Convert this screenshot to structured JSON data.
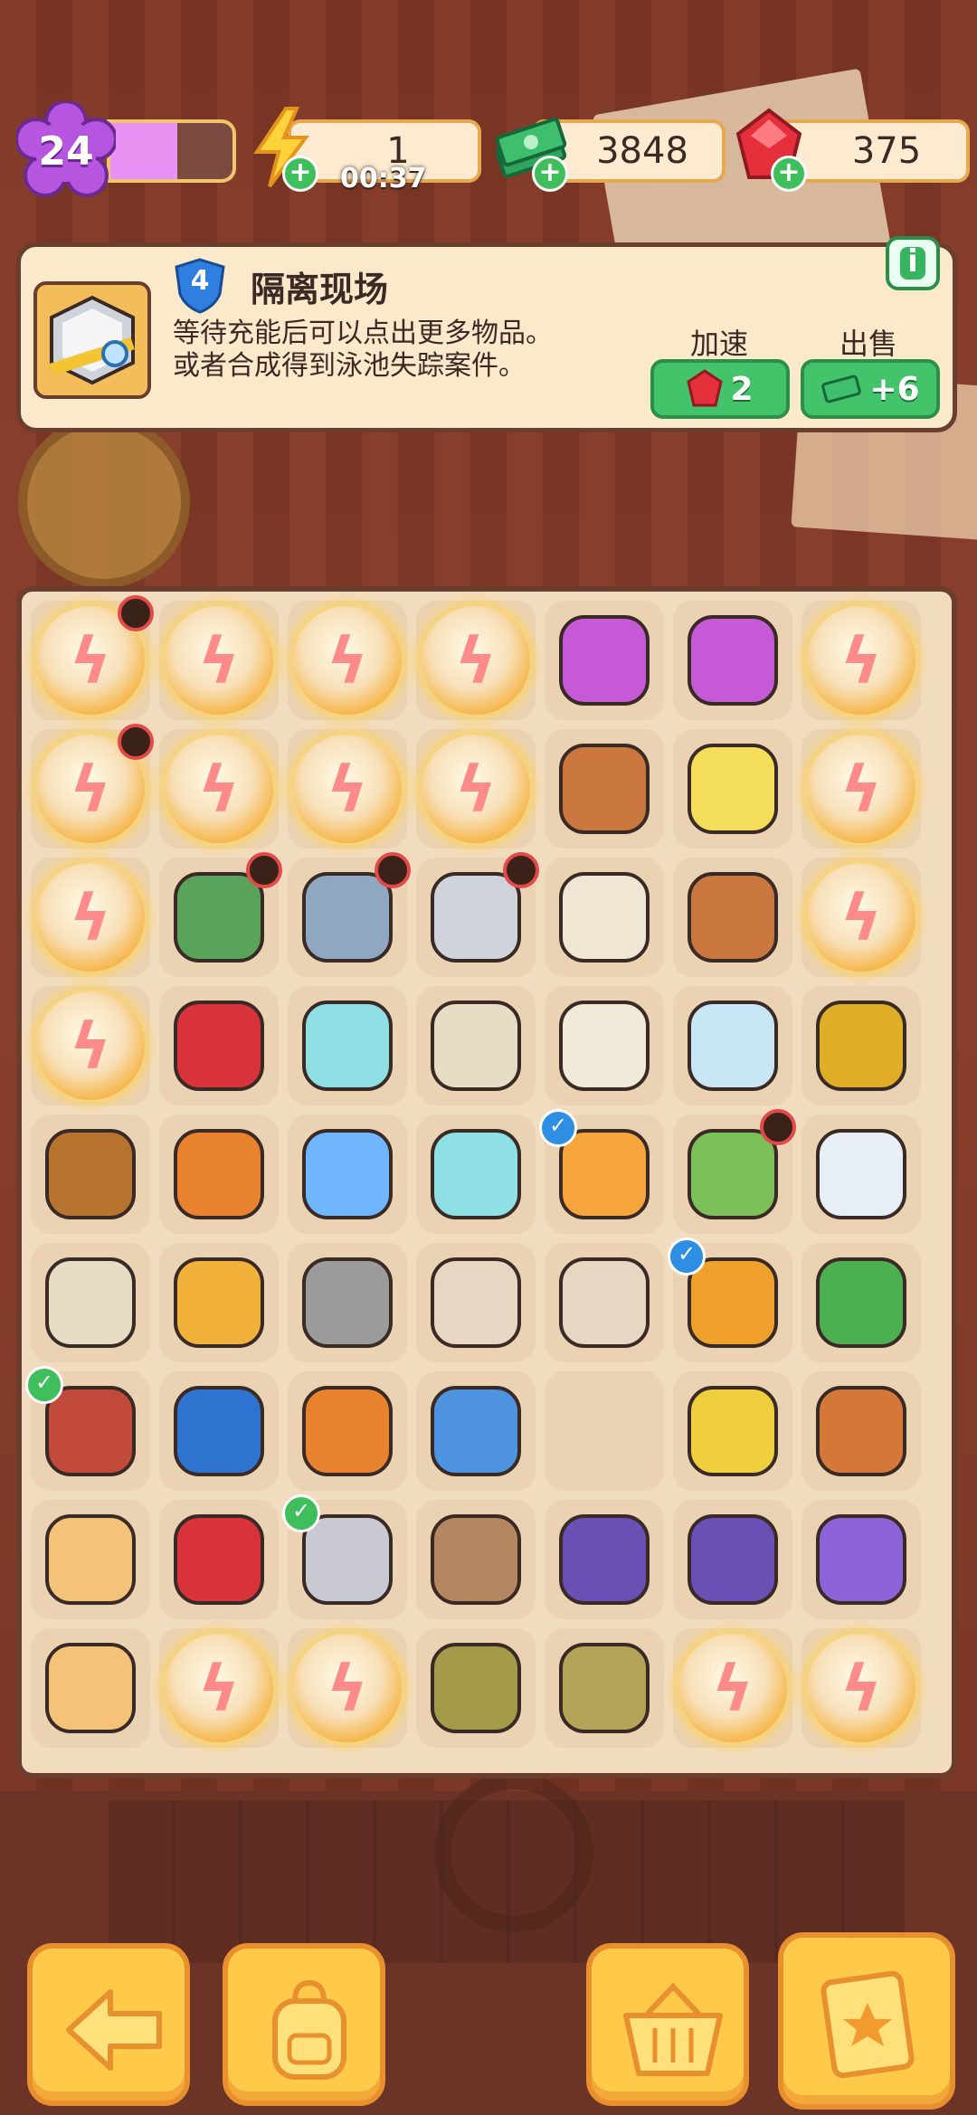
{
  "topbar": {
    "level": "24",
    "xp_progress": 0.55,
    "energy": "1",
    "energy_timer": "00:37",
    "cash": "3848",
    "gems": "375"
  },
  "panel": {
    "tier": "4",
    "title": "隔离现场",
    "desc_line1": "等待充能后可以点出更多物品。",
    "desc_line2": "或者合成得到泳池失踪案件。",
    "speedup_label": "加速",
    "speedup_cost": "2",
    "sell_label": "出售",
    "sell_value": "+6",
    "info_label": "i"
  },
  "board": {
    "rows": [
      [
        "energy-sphere-locked",
        "energy-sphere",
        "energy-sphere",
        "energy-sphere",
        "flower-crystal-basket",
        "flower-crystal-basket",
        "energy-sphere"
      ],
      [
        "energy-sphere-locked",
        "energy-sphere",
        "energy-sphere",
        "energy-sphere",
        "clay-pot",
        "sprout-mascot",
        "energy-sphere"
      ],
      [
        "energy-sphere",
        "crime-scene-green-locked",
        "crime-scene-blue-locked",
        "crime-scene-box-locked",
        "wooden-blocks",
        "clay-pot",
        "energy-sphere"
      ],
      [
        "energy-sphere",
        "red-glove",
        "medicine-jar",
        "wanted-poster",
        "toast-slices",
        "water-bottle-sock",
        "horseshoe-magnet"
      ],
      [
        "binoculars",
        "magnifier-orange",
        "blue-button",
        "medicine-flask",
        "juice-box-checked",
        "herb-bowl-locked",
        "empty-glass"
      ],
      [
        "wanted-poster",
        "orange-glasses",
        "warning-sign",
        "evidence-bag-shoes",
        "evidence-bag-glasses",
        "honey-jar-checked",
        "green-leaves"
      ],
      [
        "hammer-checked",
        "sunglasses",
        "magnifier-small",
        "magnifier-blue",
        "empty",
        "dog-bowl",
        "shoe-box"
      ],
      [
        "bread-cubes",
        "pruning-shears",
        "screwdriver-checked",
        "footprint-papers",
        "purple-wheel",
        "purple-wheels",
        "purple-scooter"
      ],
      [
        "bread-cubes",
        "energy-sphere",
        "energy-sphere",
        "rolled-scrolls",
        "newspaper-stack",
        "energy-sphere",
        "energy-sphere"
      ]
    ]
  },
  "icons": {
    "back": "arrow-left-icon",
    "backpack": "backpack-icon",
    "basket": "basket-icon",
    "cases": "case-file-icon"
  },
  "colors": {
    "accent": "#43c36a",
    "frame": "#6a3d2e",
    "board": "#f2dcc0",
    "button": "#ffc94a"
  }
}
